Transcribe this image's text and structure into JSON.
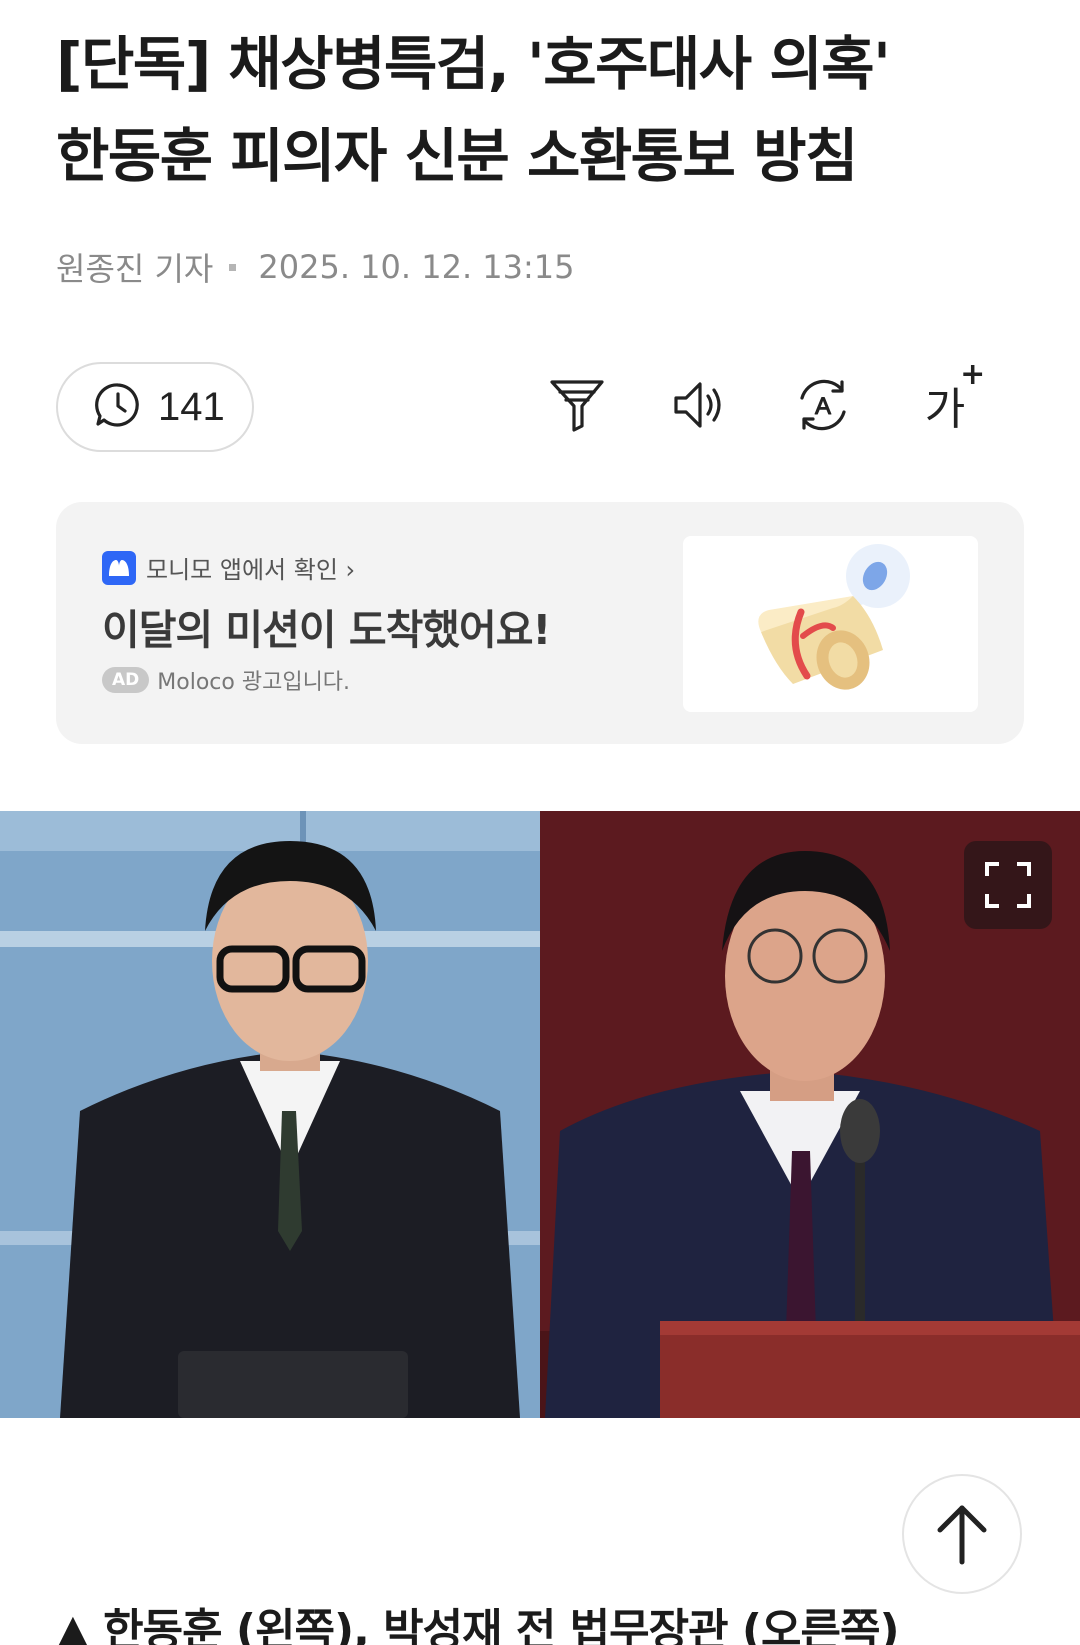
{
  "article": {
    "headline_line1": "[단독] 채상병특검, '호주대사 의혹'",
    "headline_line2": "한동훈 피의자 신분 소환통보 방침",
    "reporter": "원종진 기자",
    "timestamp": "2025. 10. 12. 13:15",
    "caption": "▲ 한동훈 (왼쪽), 박성재 전 법무장관 (오른쪽)"
  },
  "toolbar": {
    "comment_count": "141",
    "icons": [
      "comment-icon",
      "summary-filter-icon",
      "speaker-icon",
      "translate-icon",
      "font-size-icon"
    ],
    "font_size_label": "가",
    "font_size_plus": "+",
    "translate_letter": "A"
  },
  "ad": {
    "source_label": "모니모 앱에서 확인 ›",
    "title": "이달의 미션이 도착했어요!",
    "badge": "AD",
    "disclaimer": "Moloco 광고입니다.",
    "accent_color": "#2e67f6"
  },
  "photo": {
    "left_person": "한동훈",
    "right_person": "박성재"
  }
}
